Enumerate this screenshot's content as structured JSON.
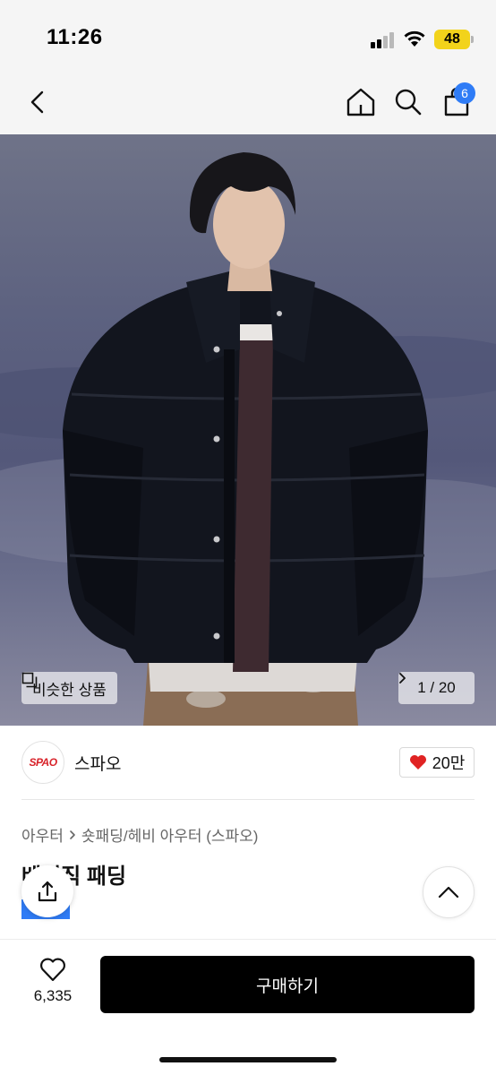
{
  "status_bar": {
    "time": "11:26",
    "battery_level": "48",
    "icons": [
      "cellular-signal-icon",
      "wifi-icon",
      "battery-icon"
    ]
  },
  "nav": {
    "icons": [
      "back-chevron-icon",
      "home-icon",
      "search-icon",
      "shopping-bag-icon"
    ],
    "cart_count": "6"
  },
  "hero": {
    "similar_label": "비슷한 상품",
    "page_indicator": "1 / 20"
  },
  "brand": {
    "logo_text": "SPAO",
    "name": "스파오",
    "likes": "20만"
  },
  "product": {
    "breadcrumb": [
      "아우터",
      "숏패딩/헤비 아우터 (스파오)"
    ],
    "title": "베이직 패딩"
  },
  "bottom_bar": {
    "wish_count": "6,335",
    "buy_label": "구매하기"
  },
  "colors": {
    "accent_blue": "#2f7cf6",
    "heart_red": "#e02323",
    "brand_red": "#d8232a",
    "battery_yellow": "#f2d31b"
  }
}
